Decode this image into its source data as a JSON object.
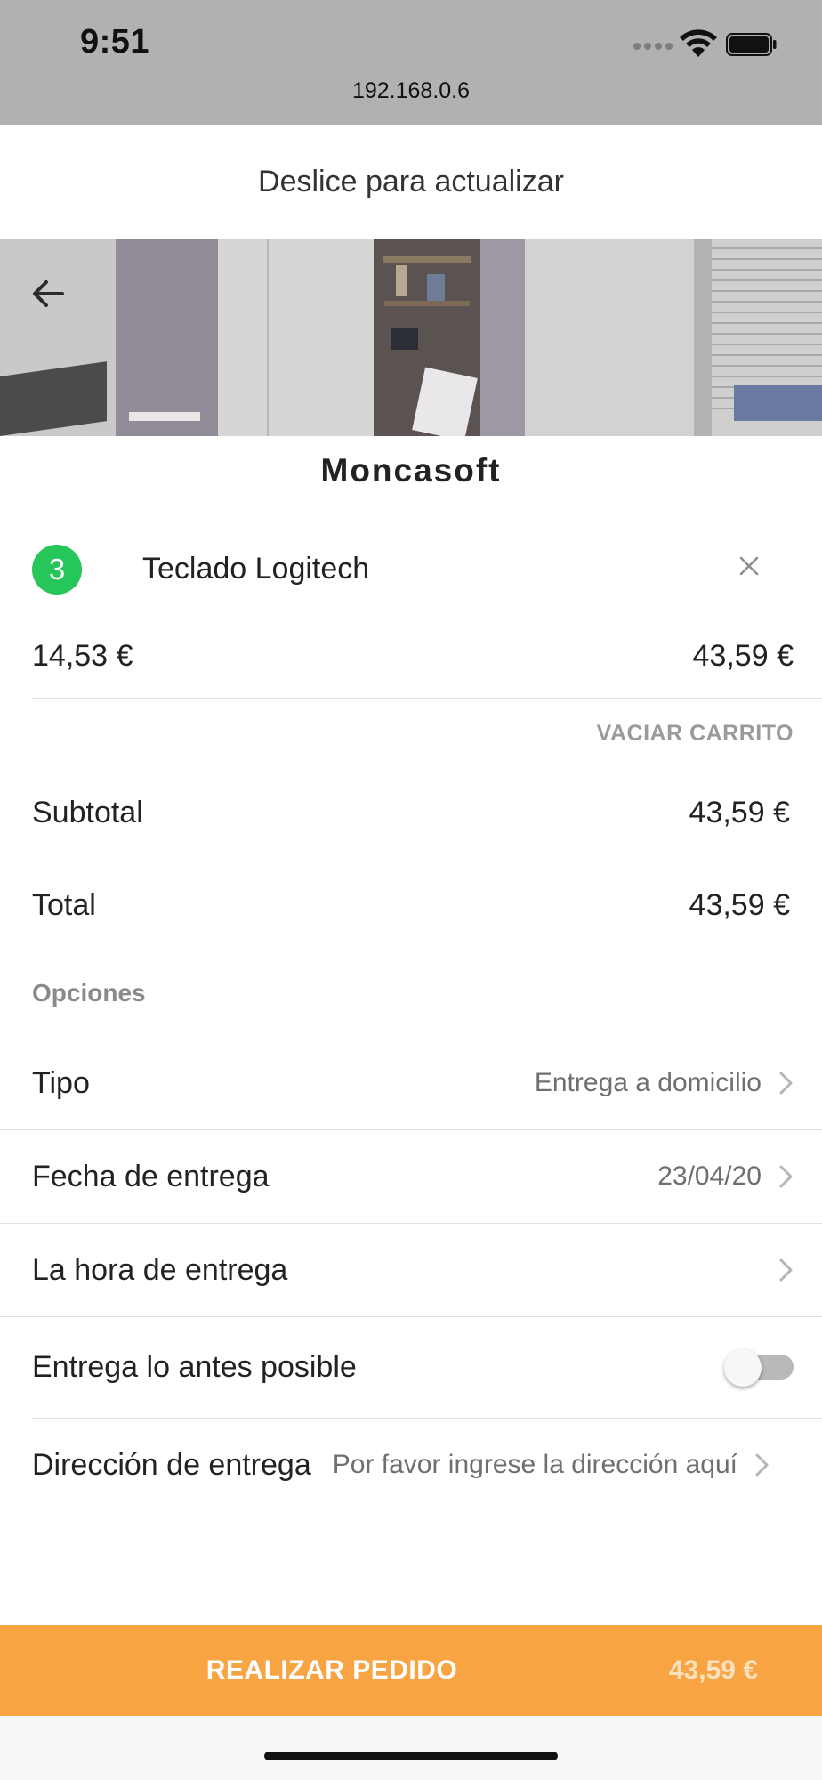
{
  "status_bar": {
    "time": "9:51",
    "url": "192.168.0.6",
    "icons": [
      "signal-dots-icon",
      "wifi-icon",
      "battery-icon"
    ]
  },
  "refresh_hint": "Deslice para actualizar",
  "header": {
    "back_icon": "arrow-left-icon",
    "store_name": "Moncasoft"
  },
  "cart": {
    "items": [
      {
        "quantity": "3",
        "name": "Teclado Logitech",
        "unit_price": "14,53 €",
        "line_total": "43,59 €",
        "remove_icon": "close-icon"
      }
    ],
    "empty_cart_label": "VACIAR CARRITO"
  },
  "summary": {
    "subtotal_label": "Subtotal",
    "subtotal_value": "43,59 €",
    "total_label": "Total",
    "total_value": "43,59 €"
  },
  "options": {
    "heading": "Opciones",
    "type_label": "Tipo",
    "type_value": "Entrega a domicilio",
    "date_label": "Fecha de entrega",
    "date_value": "23/04/20",
    "time_label": "La hora de entrega",
    "time_value": "",
    "asap_label": "Entrega lo antes posible",
    "asap_enabled": false,
    "address_label": "Dirección de entrega",
    "address_placeholder": "Por favor ingrese la dirección aquí"
  },
  "order_button": {
    "label": "REALIZAR PEDIDO",
    "price": "43,59 €"
  },
  "colors": {
    "accent_orange": "#f8a442",
    "quantity_badge_green": "#27c65a",
    "status_bar_gray": "#b0b1b2"
  }
}
